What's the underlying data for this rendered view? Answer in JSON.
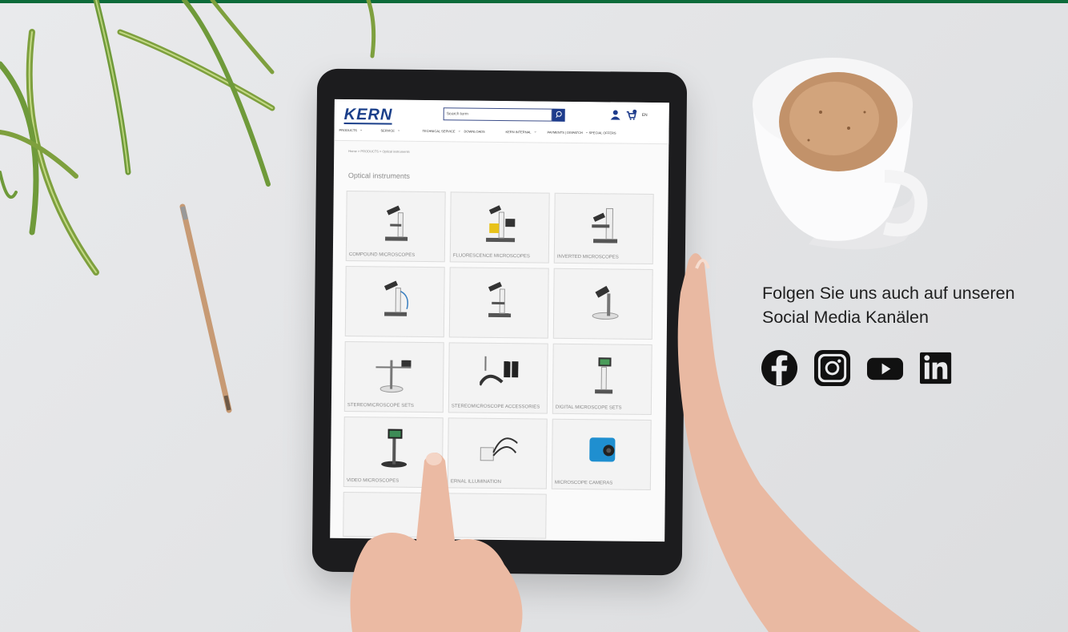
{
  "kern": {
    "logo": "KERN",
    "search_placeholder": "Search term",
    "cart_count": "0",
    "language": "EN",
    "nav": [
      {
        "label": "PRODUCTS"
      },
      {
        "label": "SERVICE"
      },
      {
        "label": "TECHNICAL SERVICE"
      },
      {
        "label": "DOWNLOADS"
      },
      {
        "label": "KERN INTERNAL"
      },
      {
        "label": "PAYMENTS | DISPATCH"
      },
      {
        "label": "SPECIAL OFFERS"
      }
    ],
    "breadcrumb": "Home > PRODUCTS > Optical instruments",
    "page_title": "Optical instruments",
    "tiles": [
      {
        "label": "COMPOUND MICROSCOPES"
      },
      {
        "label": "FLUORESCENCE MICROSCOPES"
      },
      {
        "label": "INVERTED MICROSCOPES"
      },
      {
        "label": ""
      },
      {
        "label": ""
      },
      {
        "label": ""
      },
      {
        "label": "STEREOMICROSCOPE SETS"
      },
      {
        "label": "STEREOMICROSCOPE ACCESSORIES"
      },
      {
        "label": "DIGITAL MICROSCOPE SETS"
      },
      {
        "label": "VIDEO MICROSCOPES"
      },
      {
        "label": "ERNAL ILLUMINATION"
      },
      {
        "label": "MICROSCOPE CAMERAS"
      }
    ]
  },
  "social": {
    "text": "Folgen Sie uns auch auf unseren Social Media Kanälen",
    "icons": [
      "facebook-icon",
      "instagram-icon",
      "youtube-icon",
      "linkedin-icon"
    ]
  },
  "colors": {
    "brand_green": "#0d6b3a",
    "kern_blue": "#1a3f8a",
    "text_dark": "#1e1e1e"
  }
}
